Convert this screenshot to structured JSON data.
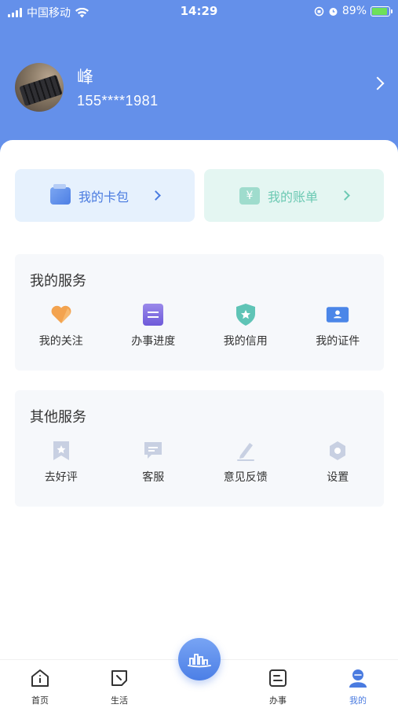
{
  "status_bar": {
    "carrier": "中国移动",
    "time": "14:29",
    "battery_percent": "89%",
    "battery_level": 0.89
  },
  "profile": {
    "name": "峰",
    "phone": "155****1981"
  },
  "quick_cards": {
    "wallet_label": "我的卡包",
    "bill_label": "我的账单",
    "bill_icon_glyph": "¥"
  },
  "my_services": {
    "title": "我的服务",
    "items": [
      {
        "label": "我的关注",
        "icon": "heart-icon"
      },
      {
        "label": "办事进度",
        "icon": "progress-doc-icon"
      },
      {
        "label": "我的信用",
        "icon": "credit-shield-icon"
      },
      {
        "label": "我的证件",
        "icon": "id-card-icon"
      }
    ]
  },
  "other_services": {
    "title": "其他服务",
    "items": [
      {
        "label": "去好评",
        "icon": "bookmark-star-icon"
      },
      {
        "label": "客服",
        "icon": "chat-icon"
      },
      {
        "label": "意见反馈",
        "icon": "pen-icon"
      },
      {
        "label": "设置",
        "icon": "settings-icon"
      }
    ]
  },
  "tab_bar": {
    "tabs": [
      {
        "label": "首页",
        "icon": "home-icon"
      },
      {
        "label": "生活",
        "icon": "life-icon"
      },
      {
        "label": "",
        "icon": "city-icon"
      },
      {
        "label": "办事",
        "icon": "tasks-icon"
      },
      {
        "label": "我的",
        "icon": "profile-icon",
        "active": true
      }
    ]
  },
  "colors": {
    "header": "#6490ea",
    "accent": "#4a7be0",
    "bill_accent": "#6cc9b3",
    "panel_bg": "#f6f8fb"
  }
}
